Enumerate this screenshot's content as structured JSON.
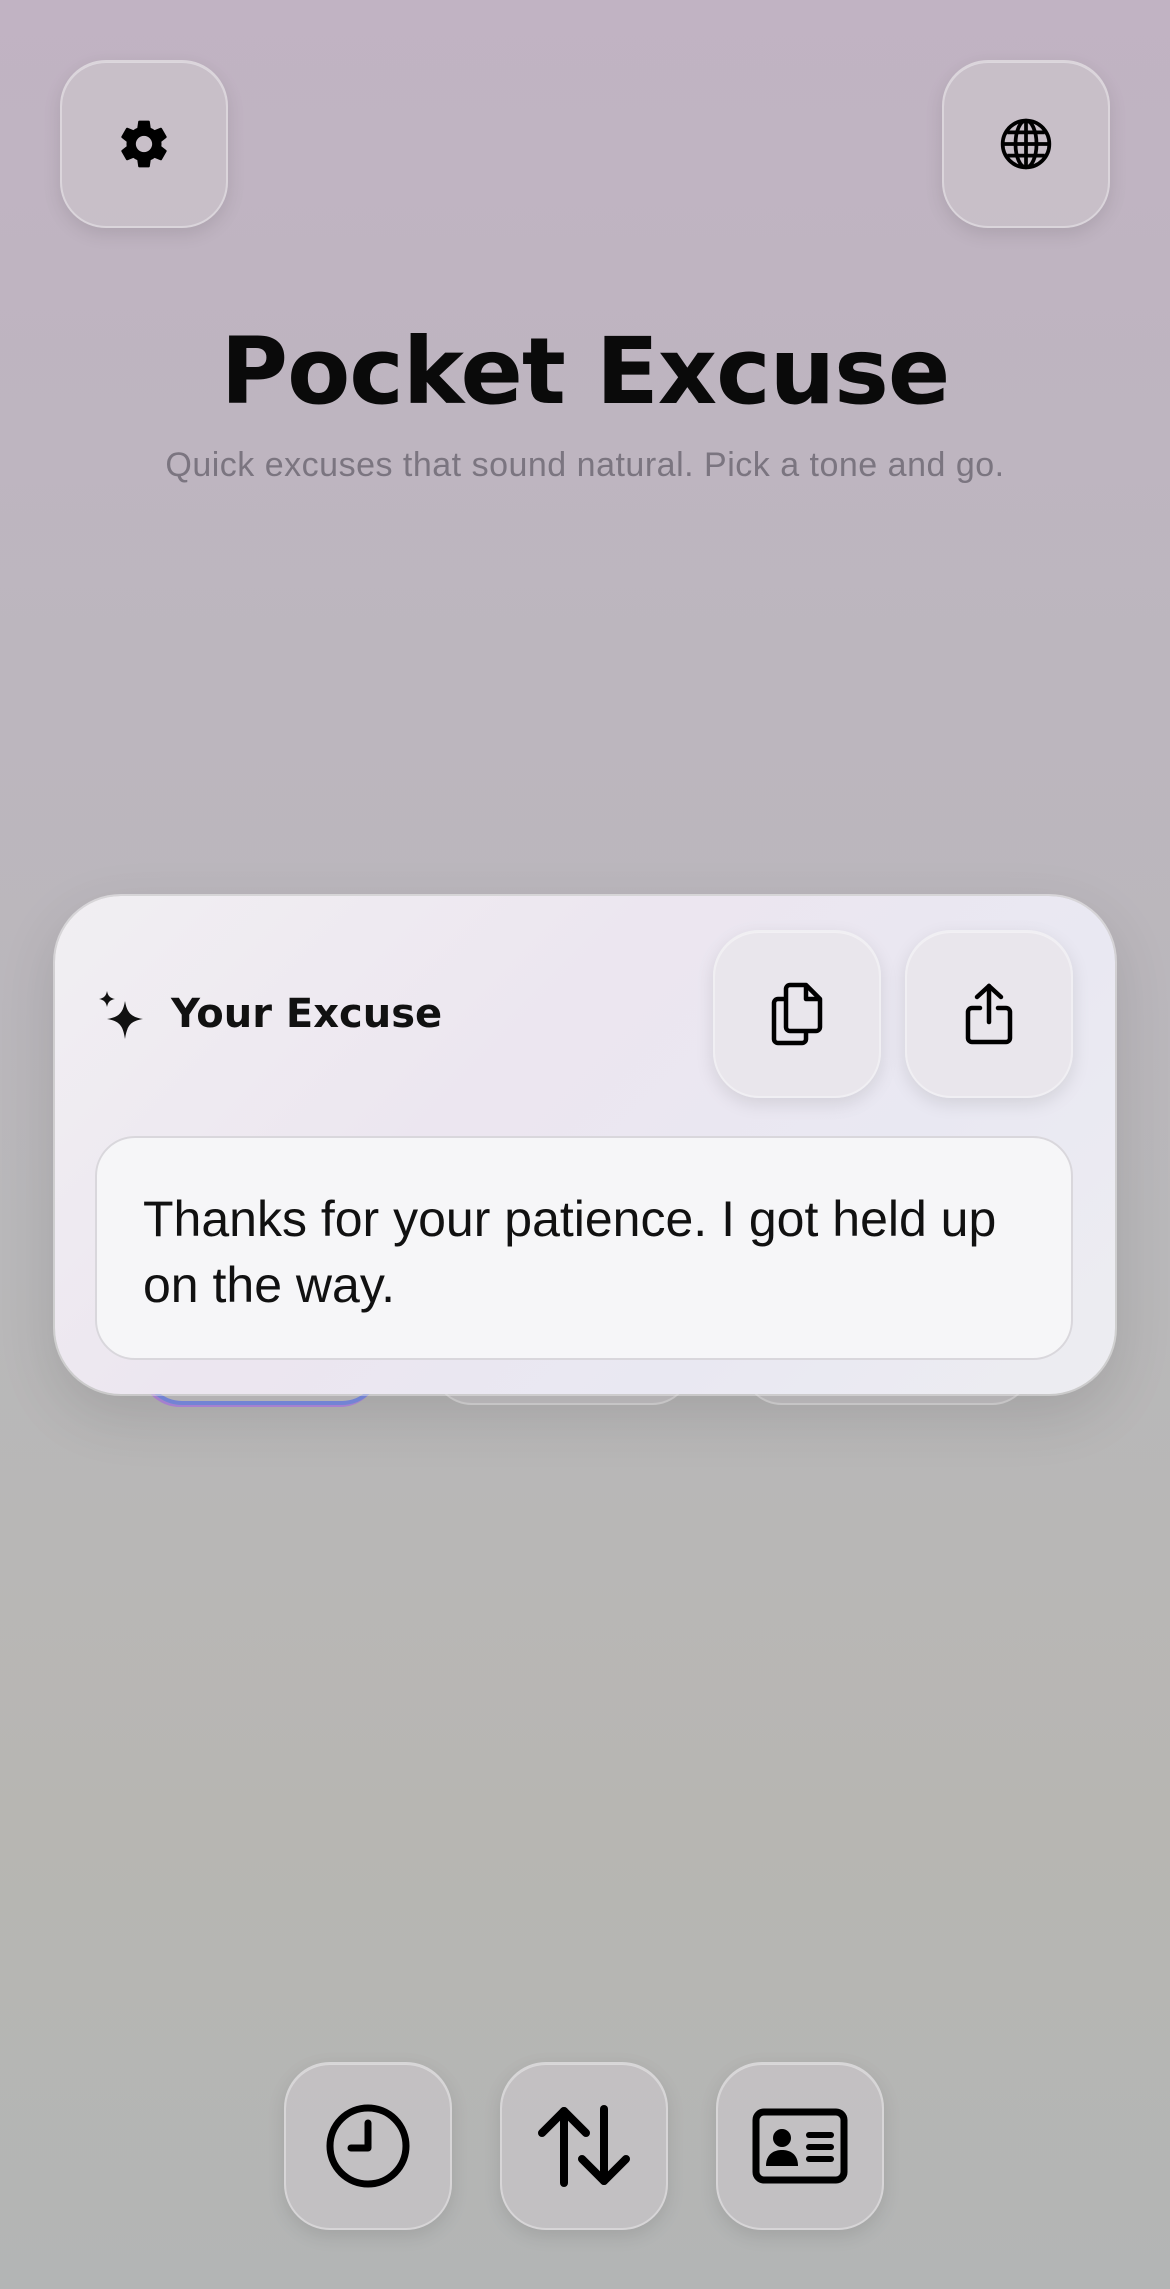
{
  "app": {
    "title": "Pocket Excuse",
    "subtitle": "Quick excuses that sound natural. Pick a tone and go."
  },
  "top_bar": {
    "left_icon": "gear-icon",
    "right_icon": "globe-icon"
  },
  "excuse_card": {
    "header_icon": "sparkles-icon",
    "header_label": "Your Excuse",
    "actions": [
      "copy-icon",
      "share-icon"
    ],
    "text": "Thanks for your patience. I got held up on the way."
  },
  "bottom_bar": {
    "icons": [
      "clock-icon",
      "swap-arrows-icon",
      "id-card-icon"
    ]
  },
  "colors": {
    "accent_gradient_start": "#b48ae0",
    "accent_gradient_end": "#7d8fe6",
    "title_text": "#0a0a0a",
    "subtitle_text": "#7b7580"
  }
}
